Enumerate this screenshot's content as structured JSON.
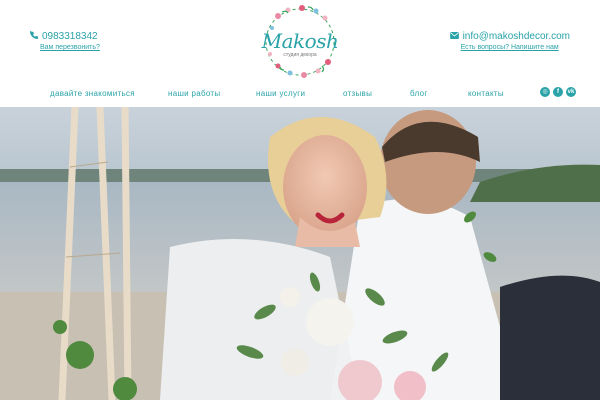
{
  "header": {
    "phone": "0983318342",
    "callback_link": "Вам перезвонить?",
    "email": "info@makoshdecor.com",
    "question_link": "Есть вопросы? Напишите нам",
    "logo_name": "Makosh",
    "logo_tagline": "студия декора"
  },
  "nav": [
    {
      "label": "давайте знакомиться"
    },
    {
      "label": "наши работы"
    },
    {
      "label": "наши услуги"
    },
    {
      "label": "отзывы"
    },
    {
      "label": "блог"
    },
    {
      "label": "контакты"
    }
  ],
  "social": [
    {
      "icon": "instagram-icon",
      "glyph": "◎"
    },
    {
      "icon": "facebook-icon",
      "glyph": "f"
    },
    {
      "icon": "vk-icon",
      "glyph": "vk"
    }
  ],
  "colors": {
    "accent": "#2aa3a8",
    "background": "#ffffff"
  }
}
